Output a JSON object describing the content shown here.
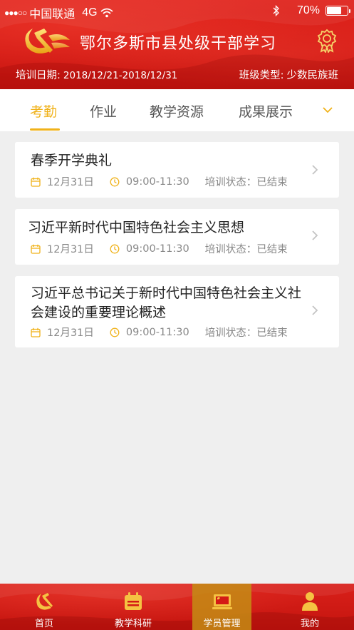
{
  "status_bar": {
    "signal": "●●●○○",
    "carrier": "中国联通",
    "network": "4G",
    "battery_percent_text": "70%",
    "battery_level": 0.7
  },
  "header": {
    "title": "鄂尔多斯市县处级干部学习",
    "training_date_label": "培训日期:",
    "training_date_value": "2018/12/21-2018/12/31",
    "class_type_label": "班级类型:",
    "class_type_value": "少数民族班"
  },
  "tabs": [
    {
      "label": "考勤",
      "active": true
    },
    {
      "label": "作业",
      "active": false
    },
    {
      "label": "教学资源",
      "active": false
    },
    {
      "label": "成果展示",
      "active": false
    }
  ],
  "list": [
    {
      "title": "春季开学典礼",
      "date": "12月31日",
      "time": "09:00-11:30",
      "status": "培训状态：已结束"
    },
    {
      "title": "习近平新时代中国特色社会主义思想",
      "date": "12月31日",
      "time": "09:00-11:30",
      "status": "培训状态：已结束"
    },
    {
      "title": "习近平总书记关于新时代中国特色社会主义社会建设的重要理论概述",
      "date": "12月31日",
      "time": "09:00-11:30",
      "status": "培训状态：已结束"
    }
  ],
  "tabbar": [
    {
      "label": "首页",
      "icon": "party-emblem-icon",
      "active": false
    },
    {
      "label": "教学科研",
      "icon": "calendar-icon",
      "active": false
    },
    {
      "label": "学员管理",
      "icon": "monitor-flag-icon",
      "active": true
    },
    {
      "label": "我的",
      "icon": "person-icon",
      "active": false
    }
  ],
  "colors": {
    "header_red": "#d41a15",
    "accent_gold": "#f0b21a",
    "background": "#efefef"
  }
}
